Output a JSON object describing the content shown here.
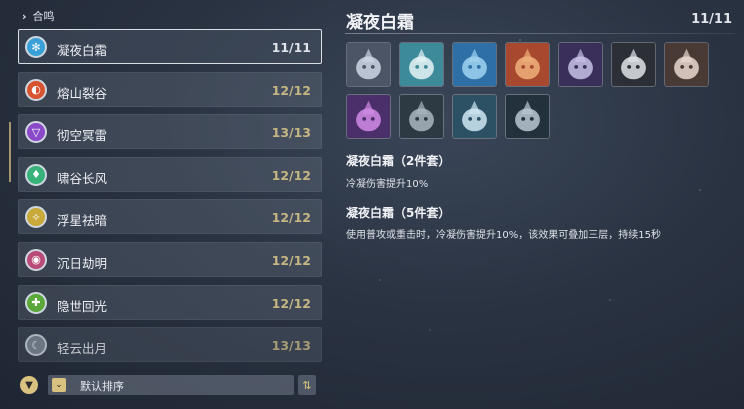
{
  "nav": {
    "breadcrumb": "合鸣"
  },
  "sets": [
    {
      "name": "凝夜白霜",
      "count": "11/11",
      "icon": "snowflake-icon",
      "color": "#3aa0d8"
    },
    {
      "name": "熔山裂谷",
      "count": "12/12",
      "icon": "flame-swirl-icon",
      "color": "#d8532f"
    },
    {
      "name": "彻空冥雷",
      "count": "13/13",
      "icon": "thunder-icon",
      "color": "#8a49c9"
    },
    {
      "name": "啸谷长风",
      "count": "12/12",
      "icon": "wind-icon",
      "color": "#36b27a"
    },
    {
      "name": "浮星祛暗",
      "count": "12/12",
      "icon": "star-icon",
      "color": "#c9a93a"
    },
    {
      "name": "沉日劫明",
      "count": "12/12",
      "icon": "sun-icon",
      "color": "#b94b78"
    },
    {
      "name": "隐世回光",
      "count": "12/12",
      "icon": "cross-heal-icon",
      "color": "#5aa83a"
    },
    {
      "name": "轻云出月",
      "count": "13/13",
      "icon": "moon-cloud-icon",
      "color": "#7f8a96"
    }
  ],
  "sort": {
    "label": "默认排序"
  },
  "detail": {
    "title": "凝夜白霜",
    "count": "11/11",
    "echoes": [
      "frost-echo-1",
      "frost-echo-2",
      "frost-echo-3",
      "frost-echo-4",
      "frost-echo-5",
      "frost-echo-6",
      "frost-echo-7",
      "frost-echo-8",
      "frost-echo-9",
      "frost-echo-10",
      "frost-echo-11"
    ],
    "bonus2_title": "凝夜白霜（2件套）",
    "bonus2_desc": "冷凝伤害提升10%",
    "bonus5_title": "凝夜白霜（5件套）",
    "bonus5_desc": "使用普攻或重击时，冷凝伤害提升10%，该效果可叠加三层，持续15秒"
  },
  "colors": {
    "accent": "#d9c27f",
    "count": "#c6b684"
  }
}
